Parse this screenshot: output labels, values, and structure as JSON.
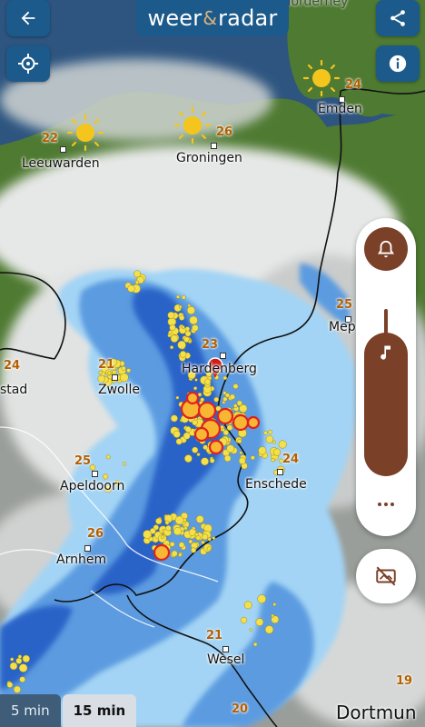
{
  "app": {
    "logo_left": "weer",
    "logo_amp": "&",
    "logo_right": "radar"
  },
  "cut_label_top": "Norderney",
  "cities": [
    {
      "name": "Leeuwarden"
    },
    {
      "name": "Groningen"
    },
    {
      "name": "Emden"
    },
    {
      "name": "Zwolle"
    },
    {
      "name": "Hardenberg"
    },
    {
      "name": "Apeldoorn"
    },
    {
      "name": "Enschede"
    },
    {
      "name": "Arnhem"
    },
    {
      "name": "Wesel"
    },
    {
      "name": "stad"
    },
    {
      "name": "Mep"
    }
  ],
  "temperatures": [
    "22",
    "26",
    "24",
    "21",
    "23",
    "25",
    "24",
    "26",
    "21",
    "19",
    "20",
    "24",
    "25"
  ],
  "sun_icons": [
    "sun-icon",
    "sun-icon",
    "sun-icon"
  ],
  "buttons": {
    "back": "back-arrow-icon",
    "locate": "crosshair-icon",
    "share": "share-icon",
    "info": "info-icon",
    "alert": "bell-icon",
    "sound": "music-note-icon",
    "more": "more-dots-icon",
    "layers_off": "layers-off-icon"
  },
  "time_buttons": [
    "5 min",
    "15 min"
  ],
  "selected_time": "15 min",
  "edge_label": "Dortmun",
  "colors": {
    "brand": "#1b5a8a",
    "panel_brown": "#7a4028",
    "lightning": "#f4e04a",
    "land": "#4f7a32",
    "water": "#2a4e7a"
  }
}
